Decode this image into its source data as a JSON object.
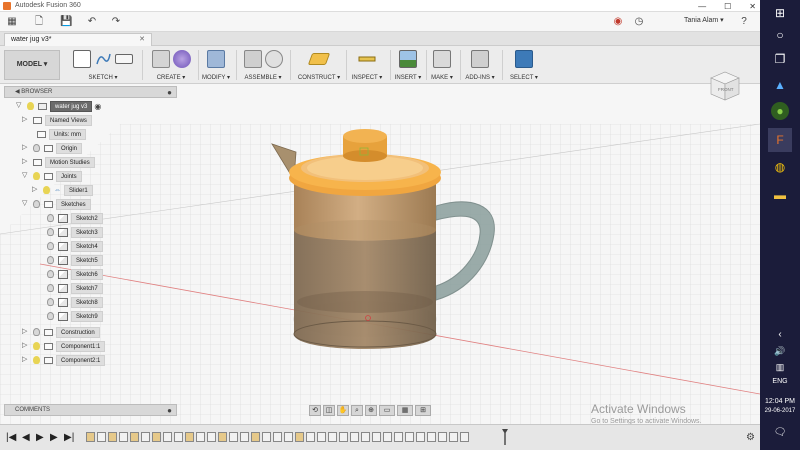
{
  "window": {
    "title": "Autodesk Fusion 360",
    "minimize": "—",
    "maximize": "☐",
    "close": "✕"
  },
  "qab": {
    "grid": "▦",
    "file": "🗋",
    "save": "💾",
    "undo": "↶",
    "redo": "↷",
    "record": "◉",
    "clock": "◷",
    "user": "Tania Alam ▾",
    "help": "?"
  },
  "doc_tab": {
    "label": "water jug v3*",
    "close": "✕"
  },
  "toolbar": {
    "model": "MODEL ▾",
    "groups": [
      {
        "name": "sketch",
        "label": "SKETCH ▾"
      },
      {
        "name": "create",
        "label": "CREATE ▾"
      },
      {
        "name": "modify",
        "label": "MODIFY ▾"
      },
      {
        "name": "assemble",
        "label": "ASSEMBLE ▾"
      },
      {
        "name": "construct",
        "label": "CONSTRUCT ▾"
      },
      {
        "name": "inspect",
        "label": "INSPECT ▾"
      },
      {
        "name": "insert",
        "label": "INSERT ▾"
      },
      {
        "name": "make",
        "label": "MAKE ▾"
      },
      {
        "name": "addins",
        "label": "ADD-INS ▾"
      },
      {
        "name": "select",
        "label": "SELECT ▾"
      }
    ]
  },
  "viewcube": {
    "face": "FRONT"
  },
  "browser": {
    "title": "◀ BROWSER",
    "pin": "●",
    "items": [
      {
        "label": "water jug v3",
        "kind": "root"
      },
      {
        "label": "Named Views",
        "kind": "folder"
      },
      {
        "label": "Units: mm",
        "kind": "units"
      },
      {
        "label": "Origin",
        "kind": "folder"
      },
      {
        "label": "Motion Studies",
        "kind": "folder"
      },
      {
        "label": "Joints",
        "kind": "folder"
      },
      {
        "label": "Slider1",
        "kind": "joint"
      },
      {
        "label": "Sketches",
        "kind": "folder"
      },
      {
        "label": "Sketch2",
        "kind": "sketch"
      },
      {
        "label": "Sketch3",
        "kind": "sketch"
      },
      {
        "label": "Sketch4",
        "kind": "sketch"
      },
      {
        "label": "Sketch5",
        "kind": "sketch"
      },
      {
        "label": "Sketch6",
        "kind": "sketch"
      },
      {
        "label": "Sketch7",
        "kind": "sketch"
      },
      {
        "label": "Sketch8",
        "kind": "sketch"
      },
      {
        "label": "Sketch9",
        "kind": "sketch"
      },
      {
        "label": "Construction",
        "kind": "folder"
      },
      {
        "label": "Component1:1",
        "kind": "component"
      },
      {
        "label": "Component2:1",
        "kind": "component"
      }
    ]
  },
  "comments": {
    "label": "COMMENTS",
    "pin": "●"
  },
  "watermark": {
    "title": "Activate Windows",
    "subtitle": "Go to Settings to activate Windows."
  },
  "timeline": {
    "first": "|◀",
    "prev": "◀",
    "play": "▶",
    "next": "▶",
    "last": "▶|",
    "settings": "⚙"
  },
  "taskbar": {
    "lang": "ENG",
    "time": "12:04 PM",
    "date": "29-06-2017",
    "chevron": "‹",
    "volume": "🔊",
    "network": "▥",
    "battery": "▭",
    "notify": "🗨"
  },
  "colors": {
    "accent": "#e8742c",
    "jug_body": "#c49a6c",
    "lid": "#f0a640",
    "handle": "#8a9e9c",
    "taskbar": "#1b1c3a"
  }
}
